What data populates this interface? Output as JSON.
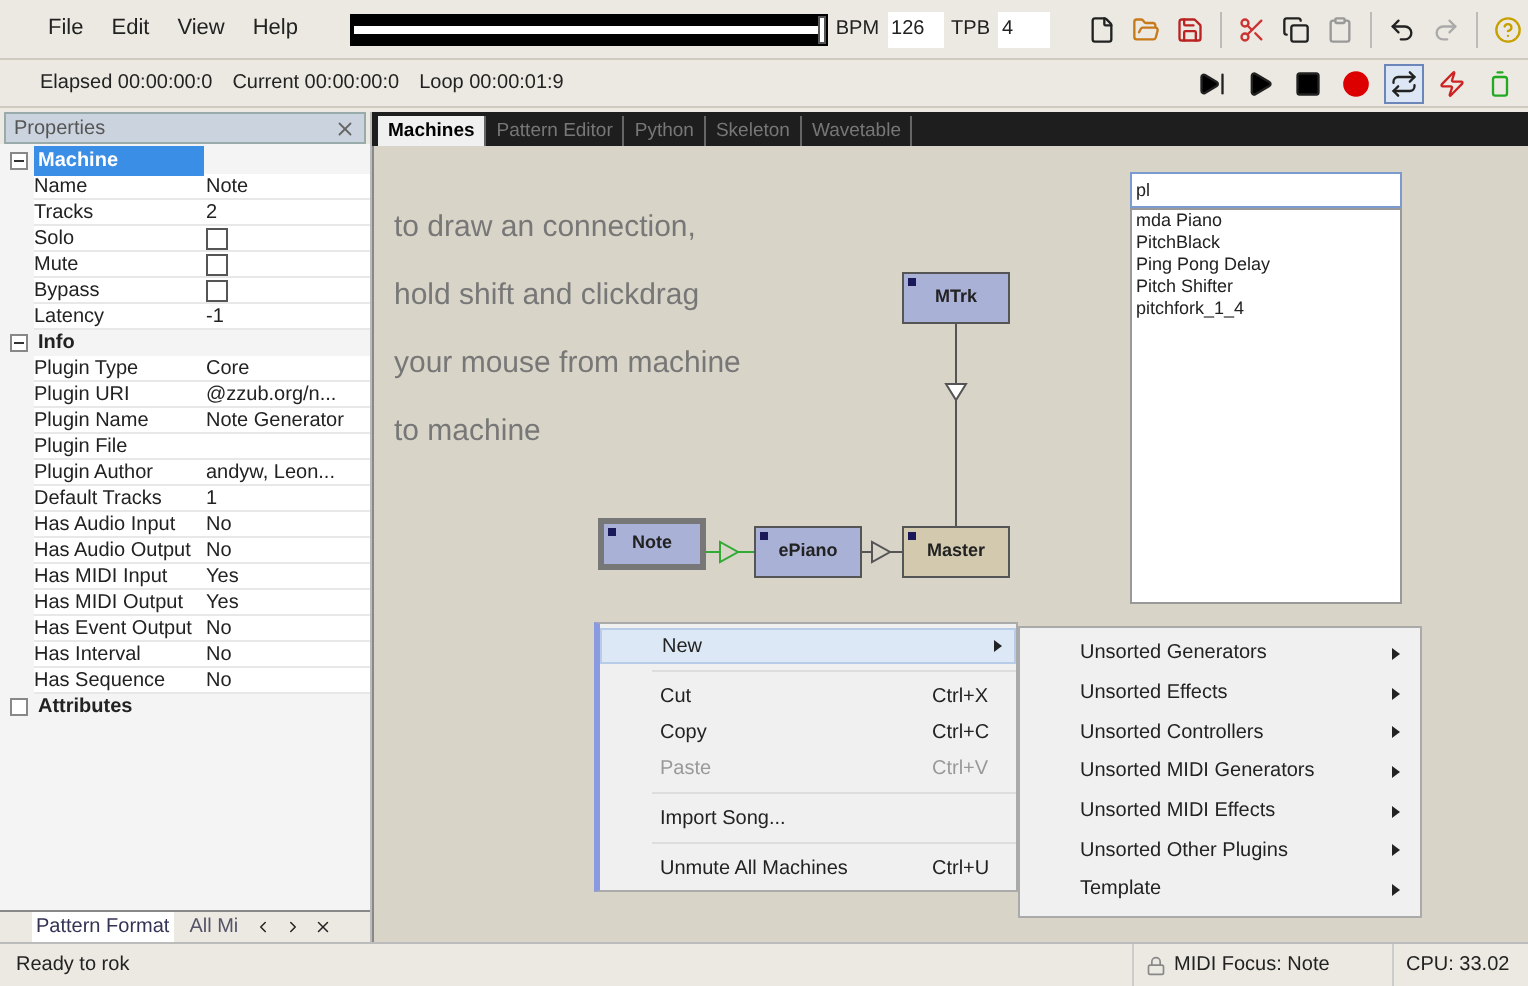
{
  "menu": [
    "File",
    "Edit",
    "View",
    "Help"
  ],
  "position": {
    "level": 1
  },
  "tempo": {
    "bpm_label": "BPM",
    "bpm": "126",
    "tpb_label": "TPB",
    "tpb": "4"
  },
  "time_info": [
    "Elapsed 00:00:00:0",
    "Current 00:00:00:0",
    "Loop 00:00:01:9"
  ],
  "transport": {
    "loop_on": true
  },
  "properties": {
    "title": "Properties",
    "groups": [
      {
        "name": "Machine",
        "expanded": true,
        "selected": true,
        "rows": [
          {
            "label": "Name",
            "kind": "text",
            "value": "Note"
          },
          {
            "label": "Tracks",
            "kind": "text",
            "value": "2"
          },
          {
            "label": "Solo",
            "kind": "checkbox",
            "checked": false
          },
          {
            "label": "Mute",
            "kind": "checkbox",
            "checked": false
          },
          {
            "label": "Bypass",
            "kind": "checkbox",
            "checked": false
          },
          {
            "label": "Latency",
            "kind": "text",
            "value": "-1"
          }
        ]
      },
      {
        "name": "Info",
        "expanded": true,
        "selected": false,
        "rows": [
          {
            "label": "Plugin Type",
            "kind": "text",
            "value": "Core"
          },
          {
            "label": "Plugin URI",
            "kind": "text",
            "value": "@zzub.org/n..."
          },
          {
            "label": "Plugin Name",
            "kind": "text",
            "value": "Note Generator"
          },
          {
            "label": "Plugin File",
            "kind": "text"
          },
          {
            "label": "Plugin Author",
            "kind": "text",
            "value": "andyw, Leon..."
          },
          {
            "label": "Default Tracks",
            "kind": "text",
            "value": "1"
          },
          {
            "label": "Has Audio Input",
            "kind": "text",
            "value": "No"
          },
          {
            "label": "Has Audio Output",
            "kind": "text",
            "value": "No"
          },
          {
            "label": "Has MIDI Input",
            "kind": "text",
            "value": "Yes"
          },
          {
            "label": "Has MIDI Output",
            "kind": "text",
            "value": "Yes"
          },
          {
            "label": "Has Event Output",
            "kind": "text",
            "value": "No"
          },
          {
            "label": "Has Interval",
            "kind": "text",
            "value": "No"
          },
          {
            "label": "Has Sequence",
            "kind": "text",
            "value": "No"
          }
        ]
      },
      {
        "name": "Attributes",
        "expanded": false,
        "selected": false
      }
    ]
  },
  "bottom_tabs": [
    {
      "label": "Pattern Format",
      "selected": true
    },
    {
      "label": "All Mi",
      "selected": false
    }
  ],
  "tabs": [
    {
      "label": "Machines",
      "selected": true
    },
    {
      "label": "Pattern Editor",
      "selected": false
    },
    {
      "label": "Python",
      "selected": false
    },
    {
      "label": "Skeleton",
      "selected": false
    },
    {
      "label": "Wavetable",
      "selected": false
    }
  ],
  "hint_lines": [
    "to draw an connection,",
    "hold shift and clickdrag",
    "your mouse from machine",
    "to machine"
  ],
  "machines": [
    {
      "name": "MTrk",
      "kind": "generator",
      "selected": false
    },
    {
      "name": "Note",
      "kind": "generator",
      "selected": true
    },
    {
      "name": "ePiano",
      "kind": "generator",
      "selected": false
    },
    {
      "name": "Master",
      "kind": "master",
      "selected": false
    }
  ],
  "search": {
    "value": "pl",
    "results": [
      "mda Piano",
      "PitchBlack",
      "Ping Pong Delay",
      "Pitch Shifter",
      "pitchfork_1_4"
    ]
  },
  "context_menu": [
    {
      "kind": "submenu",
      "label": "New",
      "highlighted": true
    },
    {
      "kind": "separator"
    },
    {
      "kind": "item",
      "label": "Cut",
      "shortcut": "Ctrl+X",
      "disabled": false
    },
    {
      "kind": "item",
      "label": "Copy",
      "shortcut": "Ctrl+C",
      "disabled": false
    },
    {
      "kind": "item",
      "label": "Paste",
      "shortcut": "Ctrl+V",
      "disabled": true
    },
    {
      "kind": "separator"
    },
    {
      "kind": "item",
      "label": "Import Song...",
      "disabled": false
    },
    {
      "kind": "separator"
    },
    {
      "kind": "item",
      "label": "Unmute All Machines",
      "shortcut": "Ctrl+U",
      "disabled": false
    }
  ],
  "submenu": [
    "Unsorted Generators",
    "Unsorted Effects",
    "Unsorted Controllers",
    "Unsorted MIDI Generators",
    "Unsorted MIDI Effects",
    "Unsorted Other Plugins",
    "Template"
  ],
  "status_bar": {
    "message": "Ready to rok",
    "midi_focus": "MIDI Focus: Note",
    "cpu": "CPU: 33.02"
  }
}
